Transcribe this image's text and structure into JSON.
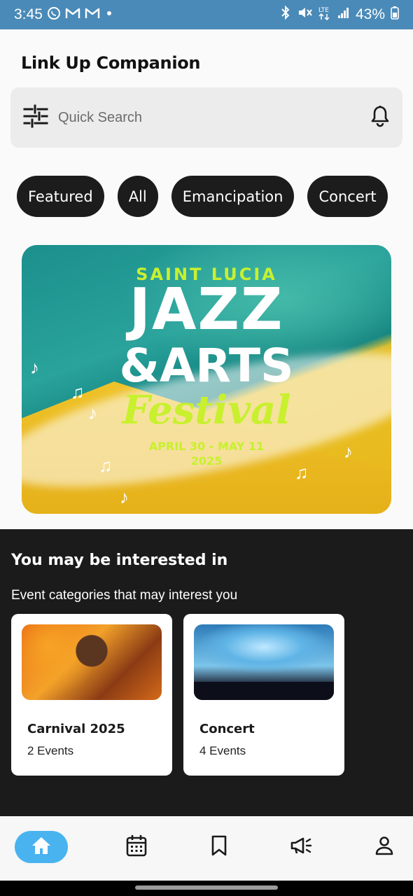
{
  "status_bar": {
    "time": "3:45",
    "battery": "43%",
    "network": "LTE",
    "left_icons": [
      "whatsapp-icon",
      "gmail-icon",
      "gmail-icon",
      "dot-icon"
    ],
    "right_icons": [
      "bluetooth-icon",
      "mute-icon",
      "lte-icon",
      "signal-icon",
      "battery-icon"
    ]
  },
  "app": {
    "title": "Link Up Companion"
  },
  "search": {
    "placeholder": "Quick Search",
    "filter_icon": "filter-icon",
    "bell_icon": "bell-icon"
  },
  "chips": [
    "Featured",
    "All",
    "Emancipation",
    "Concert"
  ],
  "banner": {
    "line1": "SAINT LUCIA",
    "line2": "JAZZ",
    "line3": "&ARTS",
    "line4": "Festival",
    "dates": "APRIL 30 - MAY 11",
    "year": "2025"
  },
  "interest": {
    "title": "You may be interested in",
    "subtitle": "Event categories that may interest you",
    "cards": [
      {
        "title": "Carnival 2025",
        "count": "2 Events"
      },
      {
        "title": "Concert",
        "count": "4 Events"
      }
    ]
  },
  "nav": {
    "items": [
      "home-icon",
      "calendar-icon",
      "bookmark-icon",
      "megaphone-icon",
      "profile-icon"
    ],
    "active": "home-icon",
    "accent": "#49b3f0"
  },
  "colors": {
    "status_bar": "#4a8ab8",
    "chip_bg": "#1c1c1c",
    "dark_section": "#1b1b1b",
    "accent_green": "#c8f02e"
  }
}
